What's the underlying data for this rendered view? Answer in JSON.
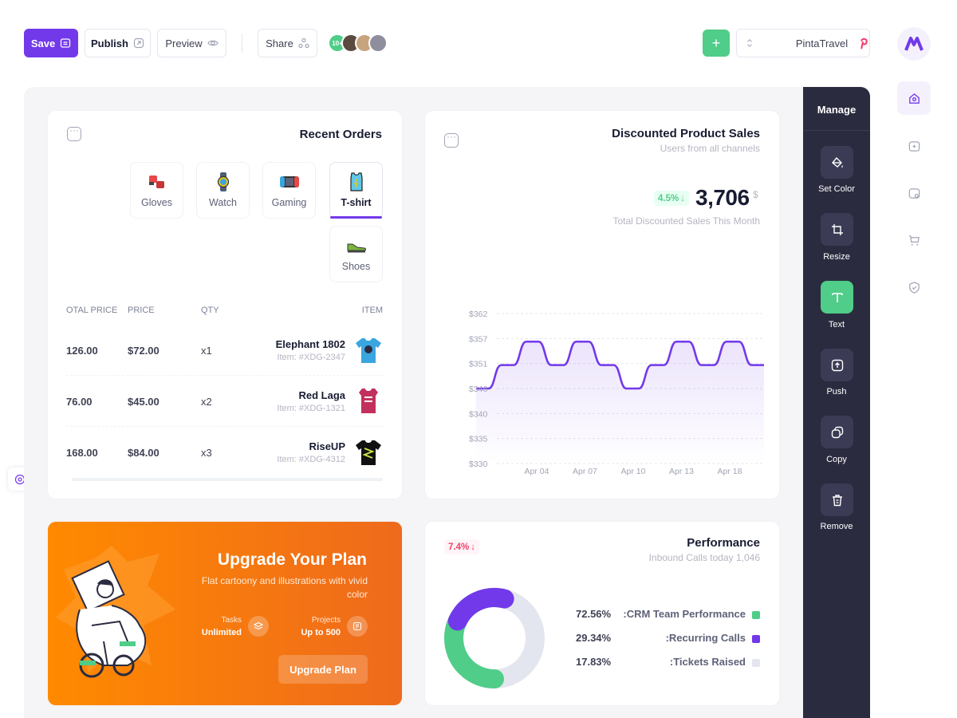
{
  "toolbar": {
    "save_label": "Save",
    "publish_label": "Publish",
    "preview_label": "Preview",
    "share_label": "Share",
    "collaborators_badge": "10+",
    "add_label": "+",
    "project_name": "PintaTravel"
  },
  "recent_orders": {
    "title": "Recent Orders",
    "tabs": [
      {
        "label": "Gloves",
        "icon": "gloves-icon"
      },
      {
        "label": "Watch",
        "icon": "watch-icon"
      },
      {
        "label": "Gaming",
        "icon": "gaming-icon"
      },
      {
        "label": "T-shirt",
        "icon": "tshirt-icon",
        "active": true
      },
      {
        "label": "Shoes",
        "icon": "shoes-icon"
      }
    ],
    "columns": {
      "total": "OTAL PRICE",
      "price": "PRICE",
      "qty": "QTY",
      "item": "ITEM"
    },
    "rows": [
      {
        "total": "126.00",
        "price": "$72.00",
        "qty": "x1",
        "name": "Elephant 1802",
        "id": "Item: #XDG-2347",
        "shirt_color": "#3aa6e0"
      },
      {
        "total": "76.00",
        "price": "$45.00",
        "qty": "x2",
        "name": "Red Laga",
        "id": "Item: #XDG-1321",
        "shirt_color": "#c2305d"
      },
      {
        "total": "168.00",
        "price": "$84.00",
        "qty": "x3",
        "name": "RiseUP",
        "id": "Item: #XDG-4312",
        "shirt_color": "#111111"
      }
    ]
  },
  "sales": {
    "title": "Discounted Product Sales",
    "subtitle": "Users from all channels",
    "badge": "4.5%",
    "value": "3,706",
    "currency": "$",
    "caption": "Total Discounted Sales This Month"
  },
  "chart_data": {
    "type": "area",
    "y_ticks": [
      "$362",
      "$357",
      "$351",
      "$346",
      "$340",
      "$335",
      "$330"
    ],
    "x_ticks": [
      "Apr 04",
      "Apr 07",
      "Apr 10",
      "Apr 13",
      "Apr 18"
    ],
    "ylim": [
      330,
      362
    ],
    "x": [
      0,
      1,
      2,
      3,
      4,
      5,
      6,
      7,
      8,
      9,
      10,
      11,
      12,
      13,
      14,
      15,
      16,
      17,
      18,
      19,
      20,
      21,
      22,
      23
    ],
    "values": [
      346,
      346,
      351,
      351,
      356,
      356,
      351,
      351,
      356,
      356,
      351,
      351,
      346,
      346,
      351,
      351,
      356,
      356,
      351,
      351,
      356,
      356,
      351,
      351
    ],
    "color": "#7239ea"
  },
  "upgrade": {
    "title": "Upgrade Your Plan",
    "subtitle": "Flat cartoony and illustrations with vivid color",
    "tasks_label": "Tasks",
    "tasks_value": "Unlimited",
    "projects_label": "Projects",
    "projects_value": "Up to 500",
    "button": "Upgrade Plan"
  },
  "performance": {
    "title": "Performance",
    "subtitle": "Inbound Calls today 1,046",
    "badge": "7.4%",
    "legend": [
      {
        "pct": "72.56%",
        "name": ":CRM Team Performance",
        "color": "#50cd89"
      },
      {
        "pct": "29.34%",
        "name": ":Recurring Calls",
        "color": "#7239ea"
      },
      {
        "pct": "17.83%",
        "name": ":Tickets Raised",
        "color": "#e4e6ef"
      }
    ]
  },
  "manage": {
    "title": "Manage",
    "tools": [
      {
        "label": "Set Color",
        "icon": "paint-bucket-icon"
      },
      {
        "label": "Resize",
        "icon": "crop-icon"
      },
      {
        "label": "Text",
        "icon": "text-icon",
        "active": true
      },
      {
        "label": "Push",
        "icon": "push-icon"
      },
      {
        "label": "Copy",
        "icon": "copy-icon"
      },
      {
        "label": "Remove",
        "icon": "trash-icon"
      }
    ]
  },
  "colors": {
    "primary": "#7239ea",
    "success": "#50cd89",
    "danger": "#f1416c",
    "dark_panel": "#2b2b40",
    "orange": "#f57a0f"
  }
}
